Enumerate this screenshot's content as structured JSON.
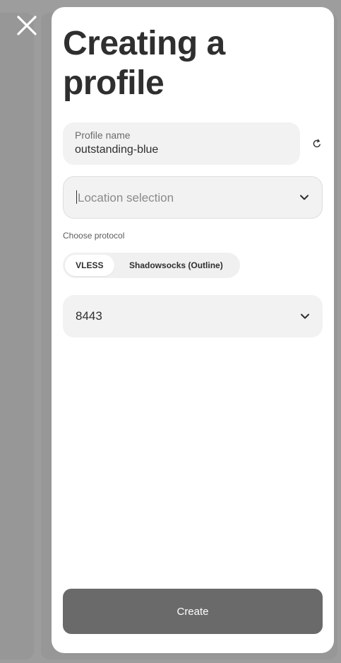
{
  "header": {
    "close_icon": "close-icon"
  },
  "modal": {
    "title": "Creating a profile",
    "profile_name": {
      "label": "Profile name",
      "value": "outstanding-blue",
      "regenerate_icon": "refresh-icon"
    },
    "location": {
      "placeholder": "Location selection",
      "icon": "chevron-down-icon"
    },
    "protocol": {
      "label": "Choose protocol",
      "options": [
        "VLESS",
        "Shadowsocks (Outline)"
      ],
      "selected": "VLESS"
    },
    "port": {
      "value": "8443",
      "icon": "chevron-down-icon"
    },
    "create_label": "Create"
  },
  "colors": {
    "backdrop": "#9d9d9d",
    "modal_bg": "#ffffff",
    "field_bg": "#f2f2f2",
    "button_bg": "#6a6a6a",
    "text": "#2f2f2f"
  }
}
